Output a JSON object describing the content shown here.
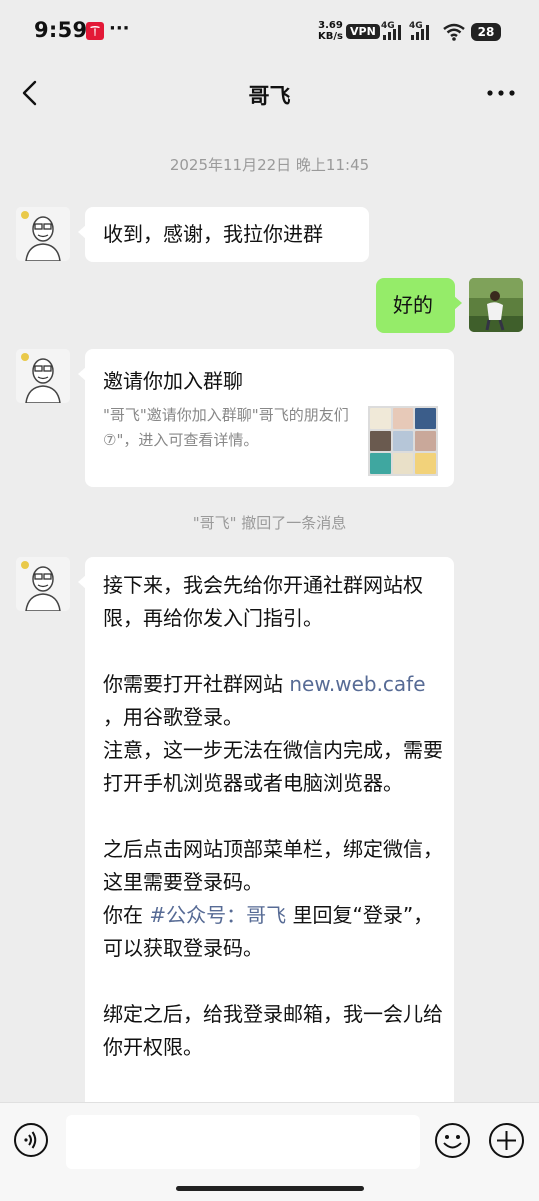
{
  "status_bar": {
    "time": "9:59",
    "more": "···",
    "speed_value": "3.69",
    "speed_unit": "KB/s",
    "vpn": "VPN",
    "net1": "4G",
    "net2": "4G",
    "battery": "28"
  },
  "header": {
    "title": "哥飞"
  },
  "chat": {
    "timestamp": "2025年11月22日 晚上11:45",
    "msg1": "收到，感谢，我拉你进群",
    "msg2": "好的",
    "invite_card": {
      "title": "邀请你加入群聊",
      "description": "\"哥飞\"邀请你加入群聊\"哥飞的朋友们⑦\"，进入可查看详情。"
    },
    "recall_notice": "\"哥飞\" 撤回了一条消息",
    "long_msg": {
      "p1": "接下来，我会先给你开通社群网站权限，再给你发入门指引。",
      "p2_prefix": "你需要打开社群网站 ",
      "p2_link": "new.web.cafe",
      "p2_suffix": " ，用谷歌登录。",
      "p3": "注意，这一步无法在微信内完成，需要打开手机浏览器或者电脑浏览器。",
      "p4": "之后点击网站顶部菜单栏，绑定微信，这里需要登录码。",
      "p5_prefix": "你在 ",
      "p5_link": "#公众号：哥飞",
      "p5_suffix": " 里回复“登录”，可以获取登录码。",
      "p6": "绑定之后，给我登录邮箱，我一会儿给你开权限。"
    }
  },
  "input_bar": {
    "placeholder": ""
  },
  "colors": {
    "background": "#ededed",
    "sent_bubble": "#95ec69",
    "link": "#576b95"
  }
}
